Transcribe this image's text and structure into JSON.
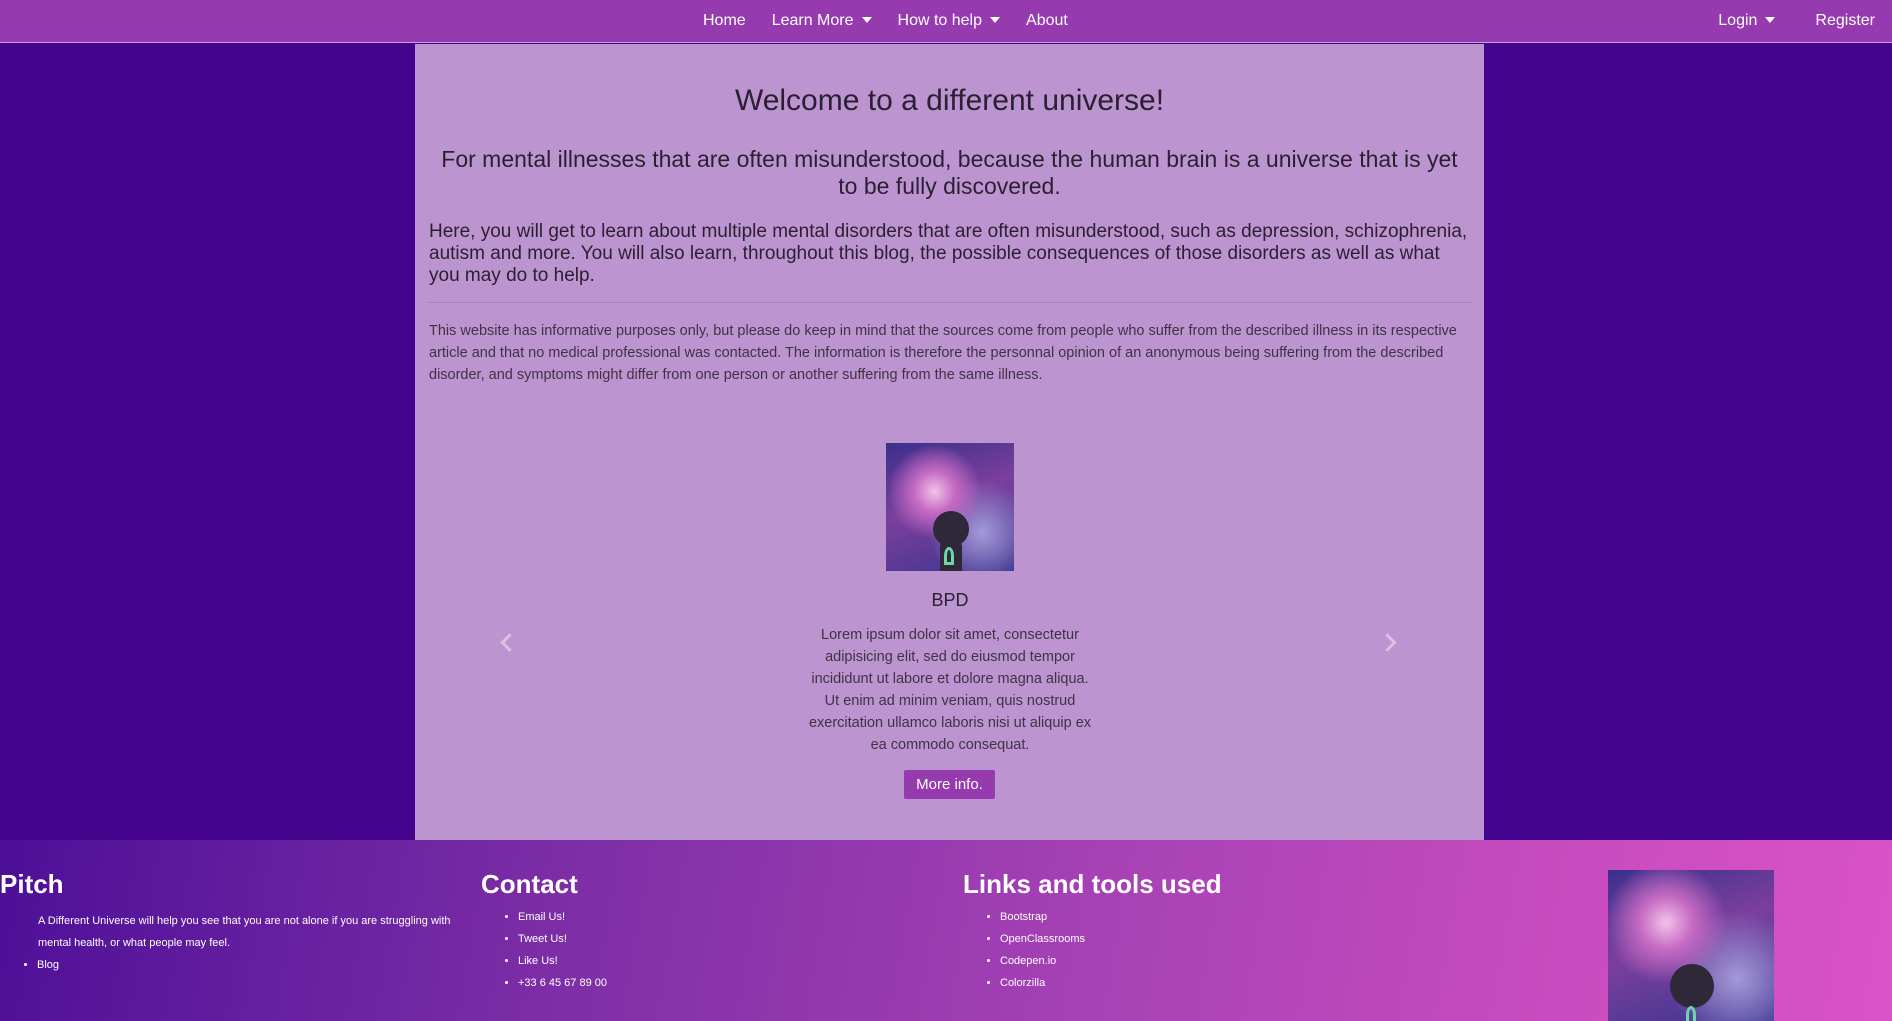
{
  "nav": {
    "center": [
      {
        "label": "Home",
        "dropdown": false
      },
      {
        "label": "Learn More",
        "dropdown": true
      },
      {
        "label": "How to help",
        "dropdown": true
      },
      {
        "label": "About",
        "dropdown": false
      }
    ],
    "login": "Login",
    "register": "Register"
  },
  "main": {
    "title": "Welcome to a different universe!",
    "subtitle": "For mental illnesses that are often misunderstood, because the human brain is a universe that is yet to be fully discovered.",
    "intro": "Here, you will get to learn about multiple mental disorders that are often misunderstood, such as depression, schizophrenia, autism and more. You will also learn, throughout this blog, the possible consequences of those disorders as well as what you may do to help.",
    "disclaimer": "This website has informative purposes only, but please do keep in mind that the sources come from people who suffer from the described illness in its respective article and that no medical professional was contacted. The information is therefore the personnal opinion of an anonymous being suffering from the described disorder, and symptoms might differ from one person or another suffering from the same illness."
  },
  "carousel": {
    "title": "BPD",
    "text": "Lorem ipsum dolor sit amet, consectetur adipisicing elit, sed do eiusmod tempor incididunt ut labore et dolore magna aliqua. Ut enim ad minim veniam, quis nostrud exercitation ullamco laboris nisi ut aliquip ex ea commodo consequat.",
    "button": "More info."
  },
  "footer": {
    "pitch": {
      "title": "Pitch",
      "text": "A Different Universe will help you see that you are not alone if you are struggling with mental health, or what people may feel.",
      "items": [
        "Blog"
      ]
    },
    "contact": {
      "title": "Contact",
      "items": [
        "Email Us!",
        "Tweet Us!",
        "Like Us!",
        "+33 6 45 67 89 00"
      ]
    },
    "links": {
      "title": "Links and tools used",
      "items": [
        "Bootstrap",
        "OpenClassrooms",
        "Codepen.io",
        "Colorzilla"
      ]
    }
  },
  "colors": {
    "page_bg": "#45048e",
    "navbar": "#963ab0",
    "panel": "#bc94cf",
    "button": "#963ab0",
    "footer_start": "#4d0f98",
    "footer_end": "#db52c8"
  }
}
